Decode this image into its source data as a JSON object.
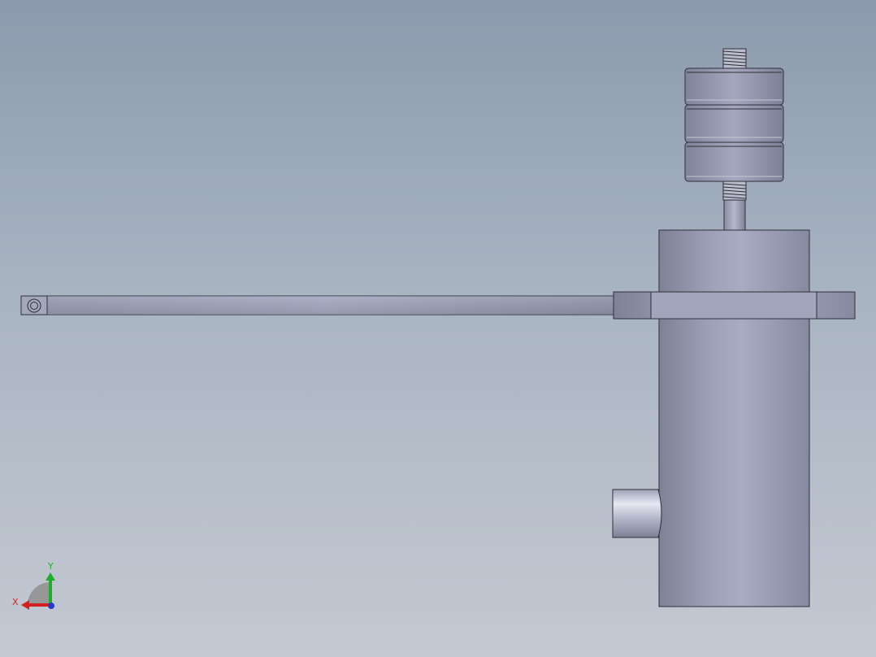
{
  "viewport": {
    "background_top": "#8b9bad",
    "background_bottom": "#c4c9d2"
  },
  "model": {
    "description_parts": [
      "lever-arm",
      "pivot-eye",
      "clamp-collar",
      "cylinder-body",
      "side-port",
      "piston-rod",
      "stacked-weights",
      "threaded-stud"
    ],
    "body_color": "#9a9db4",
    "edge_color": "#2e3038"
  },
  "triad": {
    "x_label": "X",
    "y_label": "Y",
    "x_color": "#d42020",
    "y_color": "#1fae2a",
    "z_color": "#2838c8"
  }
}
